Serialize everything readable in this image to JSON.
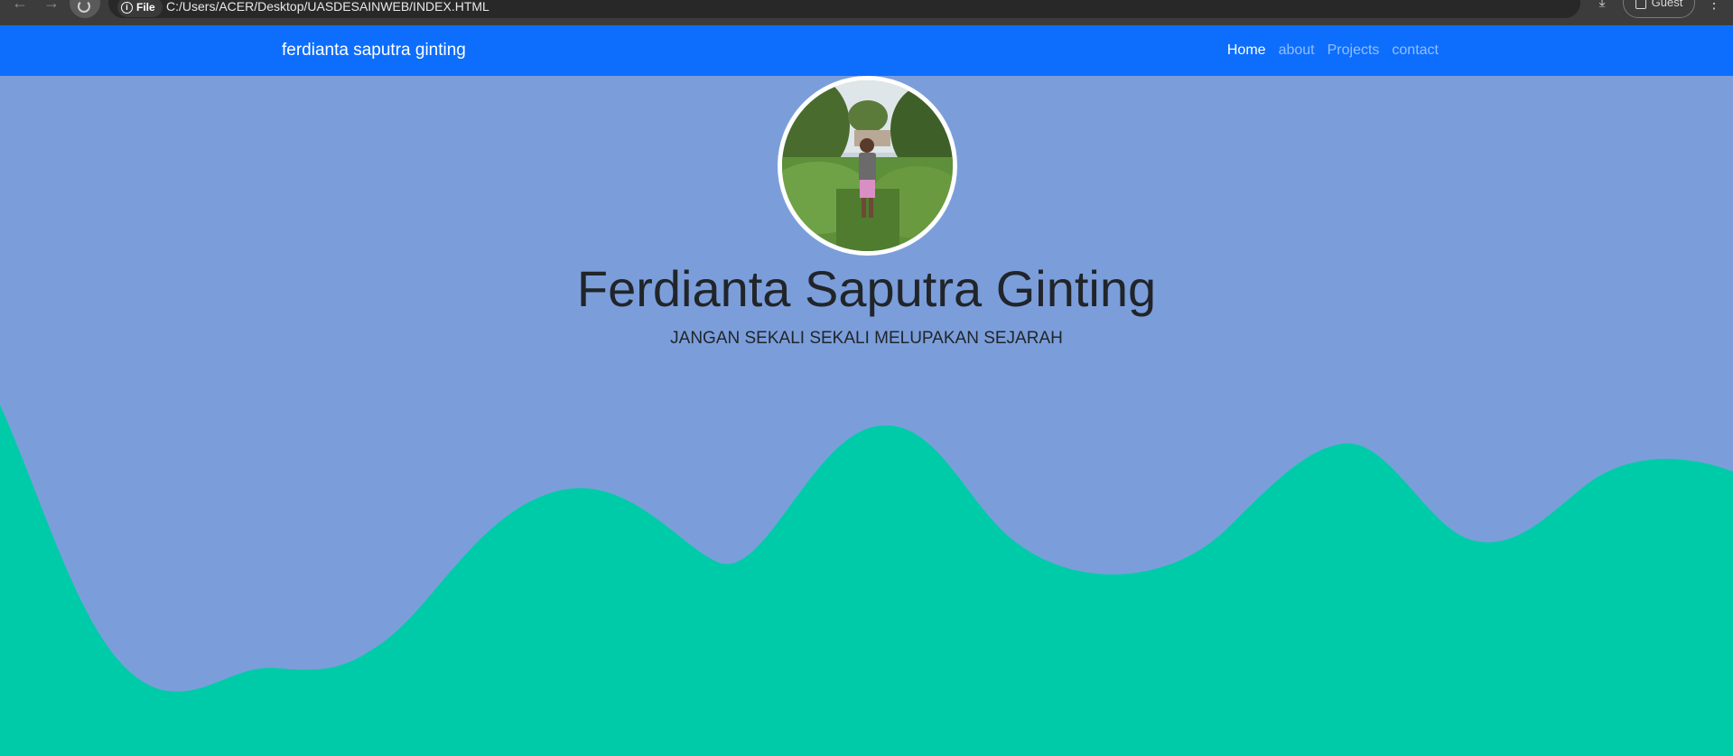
{
  "browser": {
    "file_label": "File",
    "url": "C:/Users/ACER/Desktop/UASDESAINWEB/INDEX.HTML",
    "profile_label": "Guest"
  },
  "navbar": {
    "brand": "ferdianta saputra ginting",
    "links": [
      {
        "label": "Home"
      },
      {
        "label": "about"
      },
      {
        "label": "Projects"
      },
      {
        "label": "contact"
      }
    ]
  },
  "hero": {
    "title": "Ferdianta Saputra Ginting",
    "subtitle": "JANGAN SEKALI SEKALI MELUPAKAN SEJARAH"
  },
  "colors": {
    "navbar": "#0d6efd",
    "hero_bg": "#7b9edb",
    "wave": "#00cba8"
  }
}
